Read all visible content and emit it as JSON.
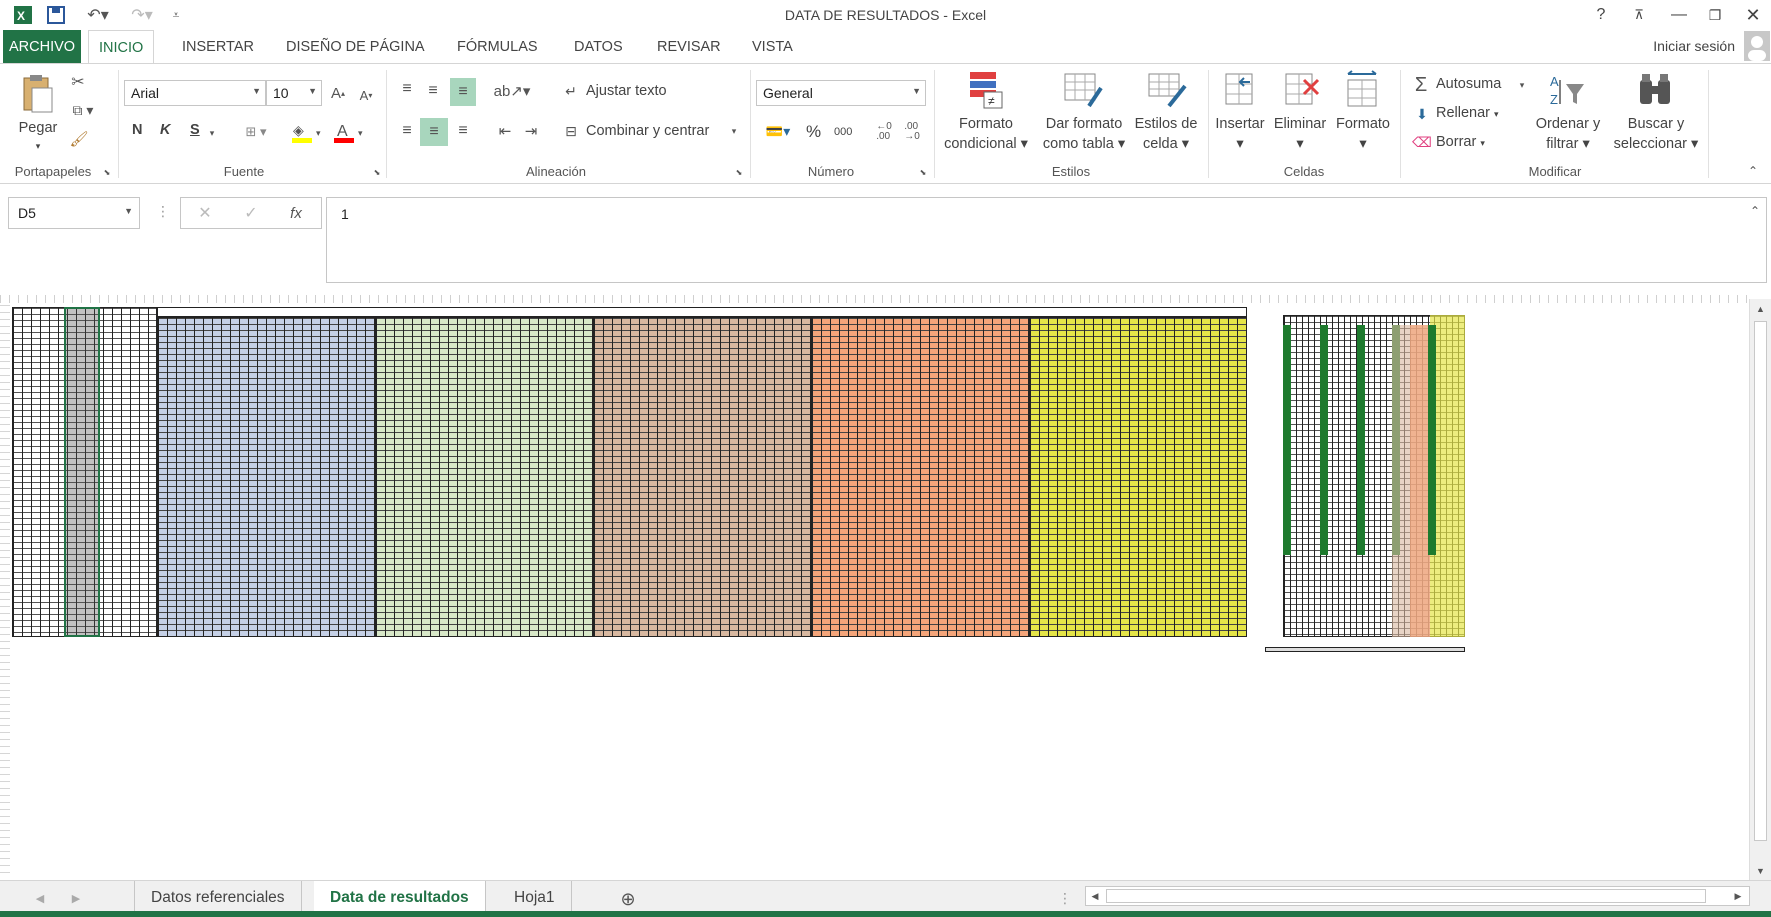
{
  "window": {
    "title": "DATA DE RESULTADOS - Excel",
    "help_icon": "?",
    "controls": [
      "restore-ribbon",
      "minimize",
      "maximize",
      "close"
    ]
  },
  "ribbon_tabs": {
    "file": "ARCHIVO",
    "items": [
      "INICIO",
      "INSERTAR",
      "DISEÑO DE PÁGINA",
      "FÓRMULAS",
      "DATOS",
      "REVISAR",
      "VISTA"
    ],
    "active": "INICIO",
    "signin": "Iniciar sesión"
  },
  "clipboard": {
    "paste": "Pegar",
    "group": "Portapapeles"
  },
  "font": {
    "name": "Arial",
    "size": "10",
    "bold": "N",
    "italic": "K",
    "strike": "S",
    "group": "Fuente",
    "highlight_color": "#ffff00",
    "font_color": "#ff0000"
  },
  "alignment": {
    "wrap": "Ajustar texto",
    "merge": "Combinar y centrar",
    "group": "Alineación"
  },
  "number": {
    "format": "General",
    "percent": "%",
    "thousands": "000",
    "group": "Número"
  },
  "styles": {
    "conditional": [
      "Formato",
      "condicional"
    ],
    "as_table": [
      "Dar formato",
      "como tabla"
    ],
    "cell_styles": [
      "Estilos de",
      "celda"
    ],
    "group": "Estilos"
  },
  "cells": {
    "insert": "Insertar",
    "delete": "Eliminar",
    "format": "Formato",
    "group": "Celdas"
  },
  "editing": {
    "autosum": "Autosuma",
    "fill": "Rellenar",
    "clear": "Borrar",
    "sort": [
      "Ordenar y",
      "filtrar"
    ],
    "find": [
      "Buscar y",
      "seleccionar"
    ],
    "group": "Modificar"
  },
  "formula_bar": {
    "name_box": "D5",
    "fx": "fx",
    "value": "1"
  },
  "sheet_tabs": {
    "items": [
      "Datos referenciales",
      "Data de resultados",
      "Hoja1"
    ],
    "active": "Data de resultados"
  },
  "colors": {
    "accent": "#217346",
    "block_blue": "#c5d0e6",
    "block_green": "#d8e8c8",
    "block_tan": "#d8b8a0",
    "block_orange": "#f4a57a",
    "block_yellow": "#e5e548"
  }
}
